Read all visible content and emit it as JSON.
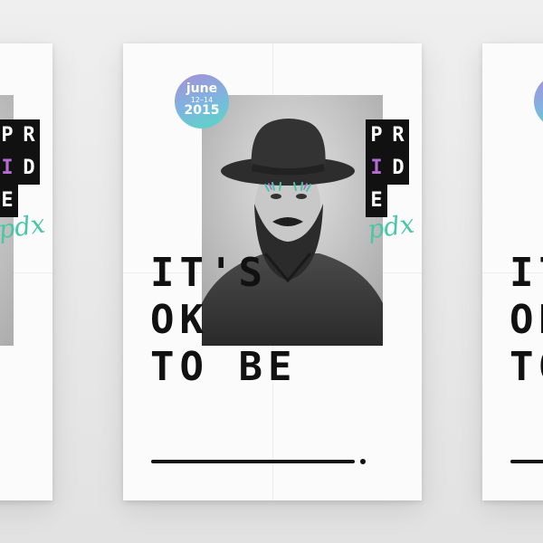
{
  "poster": {
    "badge": {
      "month": "june",
      "dates": "12–14",
      "year": "2015"
    },
    "pride_letters": [
      "P",
      "R",
      "I",
      "D",
      "E"
    ],
    "pdx_script": "pdx",
    "headline": [
      "IT'S",
      "OK",
      "TO BE"
    ],
    "colors": {
      "accent_purple": "#b66ad4",
      "accent_teal": "#48c7a7",
      "ink": "#111111"
    }
  }
}
